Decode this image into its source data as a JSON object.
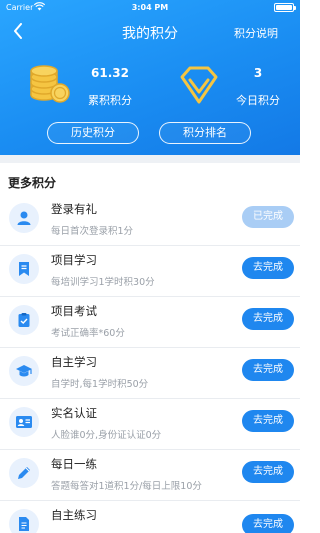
{
  "status_bar": {
    "carrier": "Carrier",
    "time": "3:04 PM"
  },
  "nav": {
    "title": "我的积分",
    "right_link": "积分说明",
    "back_icon": "chevron-left-icon"
  },
  "stats": {
    "total": {
      "value": "61.32",
      "label": "累积积分",
      "icon": "coins-icon"
    },
    "today": {
      "value": "3",
      "label": "今日积分",
      "icon": "diamond-icon"
    }
  },
  "buttons": {
    "history": "历史积分",
    "rank": "积分排名"
  },
  "section_title": "更多积分",
  "tasks": [
    {
      "name": "登录有礼",
      "desc": "每日首次登录积1分",
      "action": "已完成",
      "completed": true,
      "icon": "user-icon"
    },
    {
      "name": "项目学习",
      "desc": "每培训学习1学时积30分",
      "action": "去完成",
      "completed": false,
      "icon": "bookmark-icon"
    },
    {
      "name": "项目考试",
      "desc": "考试正确率*60分",
      "action": "去完成",
      "completed": false,
      "icon": "clipboard-check-icon"
    },
    {
      "name": "自主学习",
      "desc": "自学时,每1学时积50分",
      "action": "去完成",
      "completed": false,
      "icon": "graduation-cap-icon"
    },
    {
      "name": "实名认证",
      "desc": "人脸谁0分,身份证认证0分",
      "action": "去完成",
      "completed": false,
      "icon": "id-card-icon"
    },
    {
      "name": "每日一练",
      "desc": "答题每答对1道积1分/每日上限10分",
      "action": "去完成",
      "completed": false,
      "icon": "pencil-icon"
    },
    {
      "name": "自主练习",
      "desc": "",
      "action": "去完成",
      "completed": false,
      "icon": "document-icon"
    }
  ],
  "colors": {
    "header_blue": "#1a8df2",
    "button_blue": "#1f87ef",
    "button_done": "#a9cdf5",
    "icon_gold": "#f5c542"
  }
}
